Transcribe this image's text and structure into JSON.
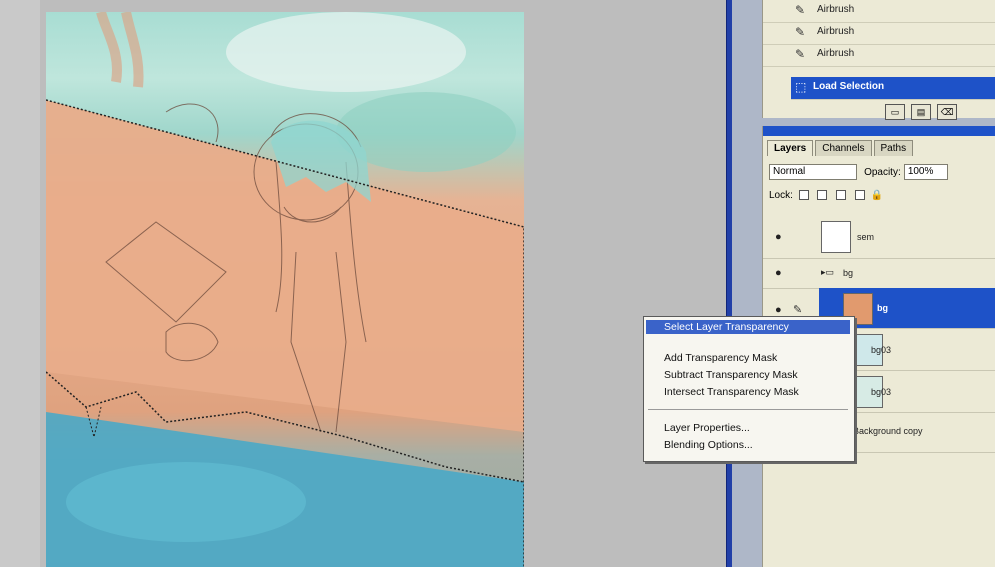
{
  "history": {
    "items": [
      {
        "label": "Airbrush",
        "icon": "airbrush-icon",
        "active": false
      },
      {
        "label": "Airbrush",
        "icon": "airbrush-icon",
        "active": false
      },
      {
        "label": "Airbrush",
        "icon": "airbrush-icon",
        "active": false
      },
      {
        "label": "Load Selection",
        "icon": "selection-icon",
        "active": true
      }
    ],
    "buttons": [
      "new-snapshot-icon",
      "new-document-icon",
      "trash-icon"
    ]
  },
  "layers_panel": {
    "tabs": [
      "Layers",
      "Channels",
      "Paths"
    ],
    "active_tab": "Layers",
    "blend_mode": "Normal",
    "opacity_label": "Opacity:",
    "opacity_value": "100%",
    "lock_label": "Lock:",
    "layers": [
      {
        "name": "sem",
        "type": "layer",
        "selected": false
      },
      {
        "name": "bg",
        "type": "folder",
        "selected": false
      },
      {
        "name": "bg",
        "type": "layer",
        "selected": true
      },
      {
        "name": "bg03",
        "type": "layer",
        "selected": false
      },
      {
        "name": "bg03",
        "type": "layer",
        "selected": false
      },
      {
        "name": "Background copy",
        "type": "layer",
        "selected": false
      }
    ]
  },
  "context_menu": {
    "items": [
      {
        "label": "Select Layer Transparency",
        "highlighted": true
      },
      {
        "label": "Add Transparency Mask",
        "highlighted": false
      },
      {
        "label": "Subtract Transparency Mask",
        "highlighted": false
      },
      {
        "label": "Intersect Transparency Mask",
        "highlighted": false
      },
      {
        "label": "Layer Properties...",
        "highlighted": false
      },
      {
        "label": "Blending Options...",
        "highlighted": false
      }
    ]
  },
  "colors": {
    "selection_blue": "#1e52c8",
    "panel_bg": "#ecead6",
    "divider_blue": "#213fa8"
  }
}
